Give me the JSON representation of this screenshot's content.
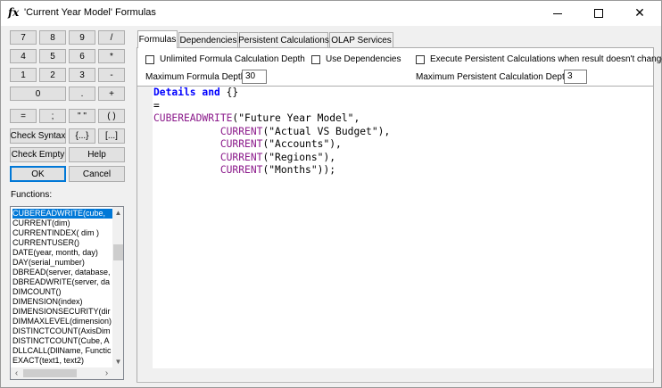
{
  "window": {
    "icon_text": "fx",
    "title": "'Current Year Model' Formulas",
    "min_glyph": "",
    "close_glyph": "✕"
  },
  "keypad": {
    "row1": [
      "7",
      "8",
      "9",
      "/"
    ],
    "row2": [
      "4",
      "5",
      "6",
      "*"
    ],
    "row3": [
      "1",
      "2",
      "3",
      "-"
    ],
    "row4": [
      "0",
      ".",
      "+"
    ],
    "row5": [
      "=",
      ";",
      "\" \"",
      "( )"
    ],
    "check_syntax": "Check Syntax",
    "brace": "{...}",
    "bracket": "[...]",
    "check_empty": "Check Empty",
    "help": "Help",
    "ok": "OK",
    "cancel": "Cancel"
  },
  "functions": {
    "label": "Functions:",
    "items": [
      "CUBEREADWRITE(cube,",
      "CURRENT(dim)",
      "CURRENTINDEX( dim )",
      "CURRENTUSER()",
      "DATE(year, month, day)",
      "DAY(serial_number)",
      "DBREAD(server, database,",
      "DBREADWRITE(server, da",
      "DIMCOUNT()",
      "DIMENSION(index)",
      "DIMENSIONSECURITY(dir",
      "DIMMAXLEVEL(dimension)",
      "DISTINCTCOUNT(AxisDim",
      "DISTINCTCOUNT(Cube, A",
      "DLLCALL(DllName, Functic",
      "EXACT(text1, text2)"
    ],
    "selected_index": 0
  },
  "tabs": [
    "Formulas",
    "Dependencies",
    "Persistent Calculations",
    "OLAP Services"
  ],
  "active_tab": "Formulas",
  "options": {
    "unlimited_depth": "Unlimited Formula Calculation Depth",
    "use_dependencies": "Use Dependencies",
    "execute_persistent": "Execute Persistent Calculations when result doesn't change",
    "max_formula_depth_label": "Maximum Formula Depth:",
    "max_formula_depth_value": "30",
    "max_persistent_depth_label": "Maximum Persistent Calculation Depth:",
    "max_persistent_depth_value": "3"
  },
  "editor": {
    "line1_kw1": "Details",
    "line1_kw2": "and",
    "line1_rest": " {}",
    "line2": "=",
    "line3_fn": "CUBEREADWRITE",
    "line3_rest": "(\"Future Year Model\",",
    "line4_fn": "CURRENT",
    "line4_rest": "(\"Actual VS Budget\"),",
    "line5_fn": "CURRENT",
    "line5_rest": "(\"Accounts\"),",
    "line6_fn": "CURRENT",
    "line6_rest": "(\"Regions\"),",
    "line7_fn": "CURRENT",
    "line7_rest": "(\"Months\"));"
  }
}
